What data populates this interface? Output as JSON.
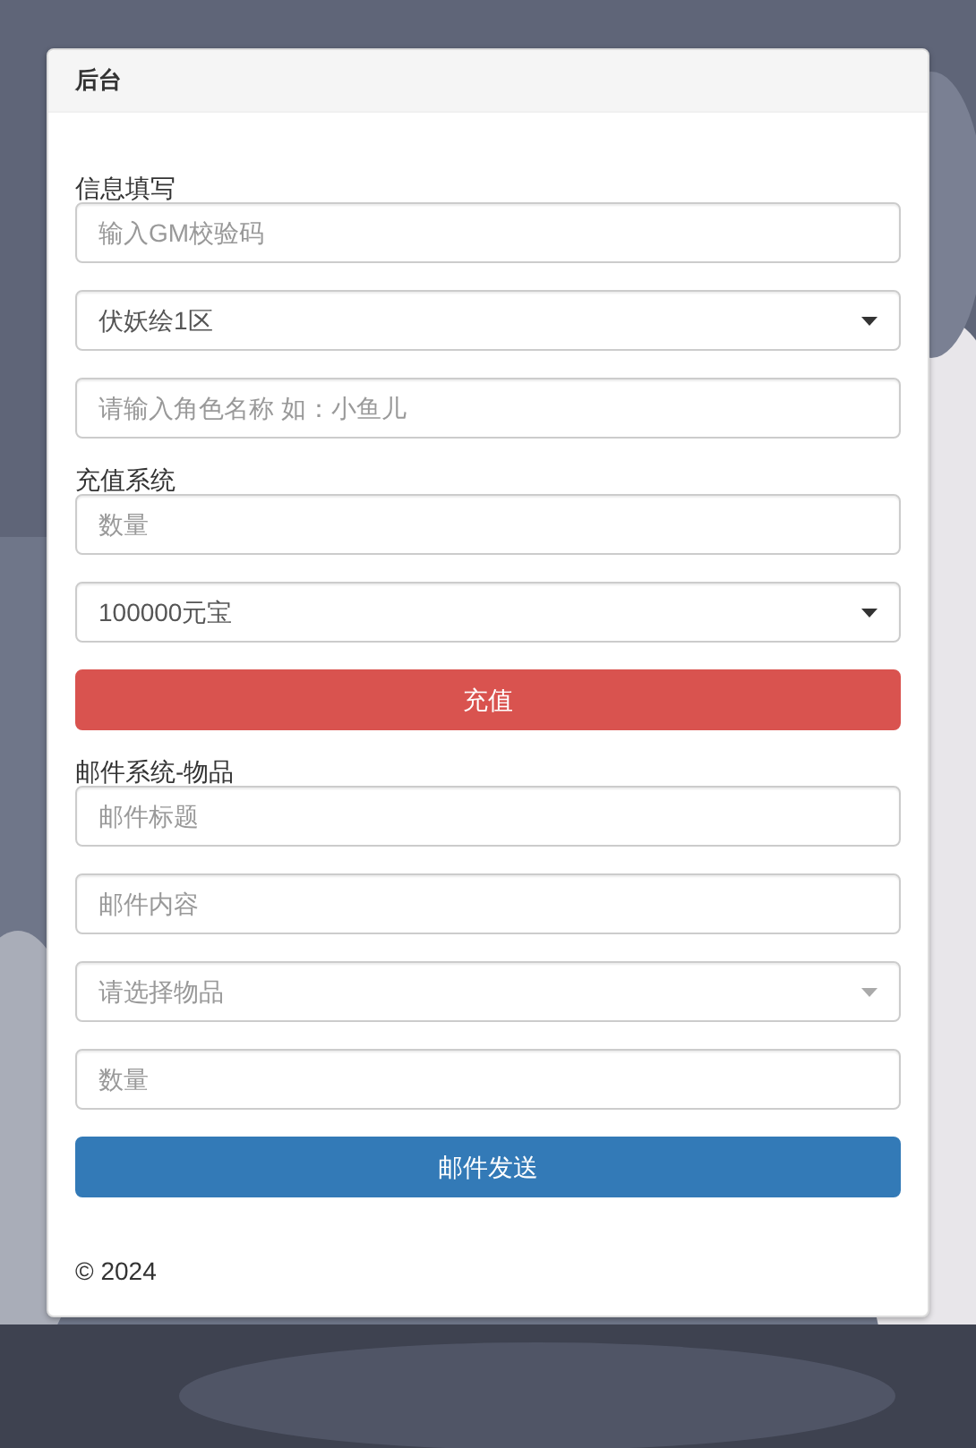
{
  "panel": {
    "title": "后台",
    "items": [
      {
        "kind": "label",
        "text": "信息填写"
      },
      {
        "kind": "input",
        "placeholder": "输入GM校验码"
      },
      {
        "kind": "select",
        "value": "伏妖绘1区"
      },
      {
        "kind": "input",
        "placeholder": "请输入角色名称 如：小鱼儿"
      },
      {
        "kind": "label",
        "text": "充值系统"
      },
      {
        "kind": "input",
        "placeholder": "数量"
      },
      {
        "kind": "select",
        "value": "100000元宝"
      },
      {
        "kind": "button",
        "color": "#d9534f",
        "text": "充值"
      },
      {
        "kind": "label",
        "text": "邮件系统-物品"
      },
      {
        "kind": "input",
        "placeholder": "邮件标题"
      },
      {
        "kind": "input",
        "placeholder": "邮件内容"
      },
      {
        "kind": "select",
        "placeholder": "请选择物品"
      },
      {
        "kind": "input",
        "placeholder": "数量"
      },
      {
        "kind": "button",
        "color": "#337ab7",
        "text": "邮件发送"
      }
    ],
    "footer": "© 2024"
  }
}
